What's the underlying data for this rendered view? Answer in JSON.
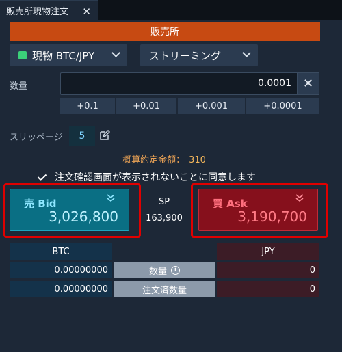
{
  "tab": {
    "title": "販売所現物注文",
    "close": "✕"
  },
  "banner": {
    "label": "販売所",
    "color": "#c74a12"
  },
  "pair_select": {
    "value": "現物 BTC/JPY",
    "indicator_color": "#3bd07a"
  },
  "mode_select": {
    "value": "ストリーミング"
  },
  "quantity": {
    "label": "数量",
    "value": "0.0001",
    "clear": "✕"
  },
  "increments": [
    "+0.1",
    "+0.01",
    "+0.001",
    "+0.0001"
  ],
  "slippage": {
    "label": "スリッページ",
    "value": "5",
    "edit_icon": "edit-icon"
  },
  "estimate": {
    "label": "概算約定金額：",
    "value": "310"
  },
  "agree": {
    "label": "注文確認画面が表示されないことに同意します",
    "checked": true
  },
  "bid": {
    "label": "売 Bid",
    "price": "3,026,800",
    "color": "#0a6f84"
  },
  "ask": {
    "label": "買 Ask",
    "price": "3,190,700",
    "color": "#86101c"
  },
  "spread": {
    "label": "SP",
    "value": "163,900"
  },
  "table": {
    "btc_header": "BTC",
    "jpy_header": "JPY",
    "rows": [
      {
        "btc": "0.00000000",
        "label": "数量",
        "jpy": "0"
      },
      {
        "btc": "0.00000000",
        "label": "注文済数量",
        "jpy": "0"
      }
    ]
  }
}
